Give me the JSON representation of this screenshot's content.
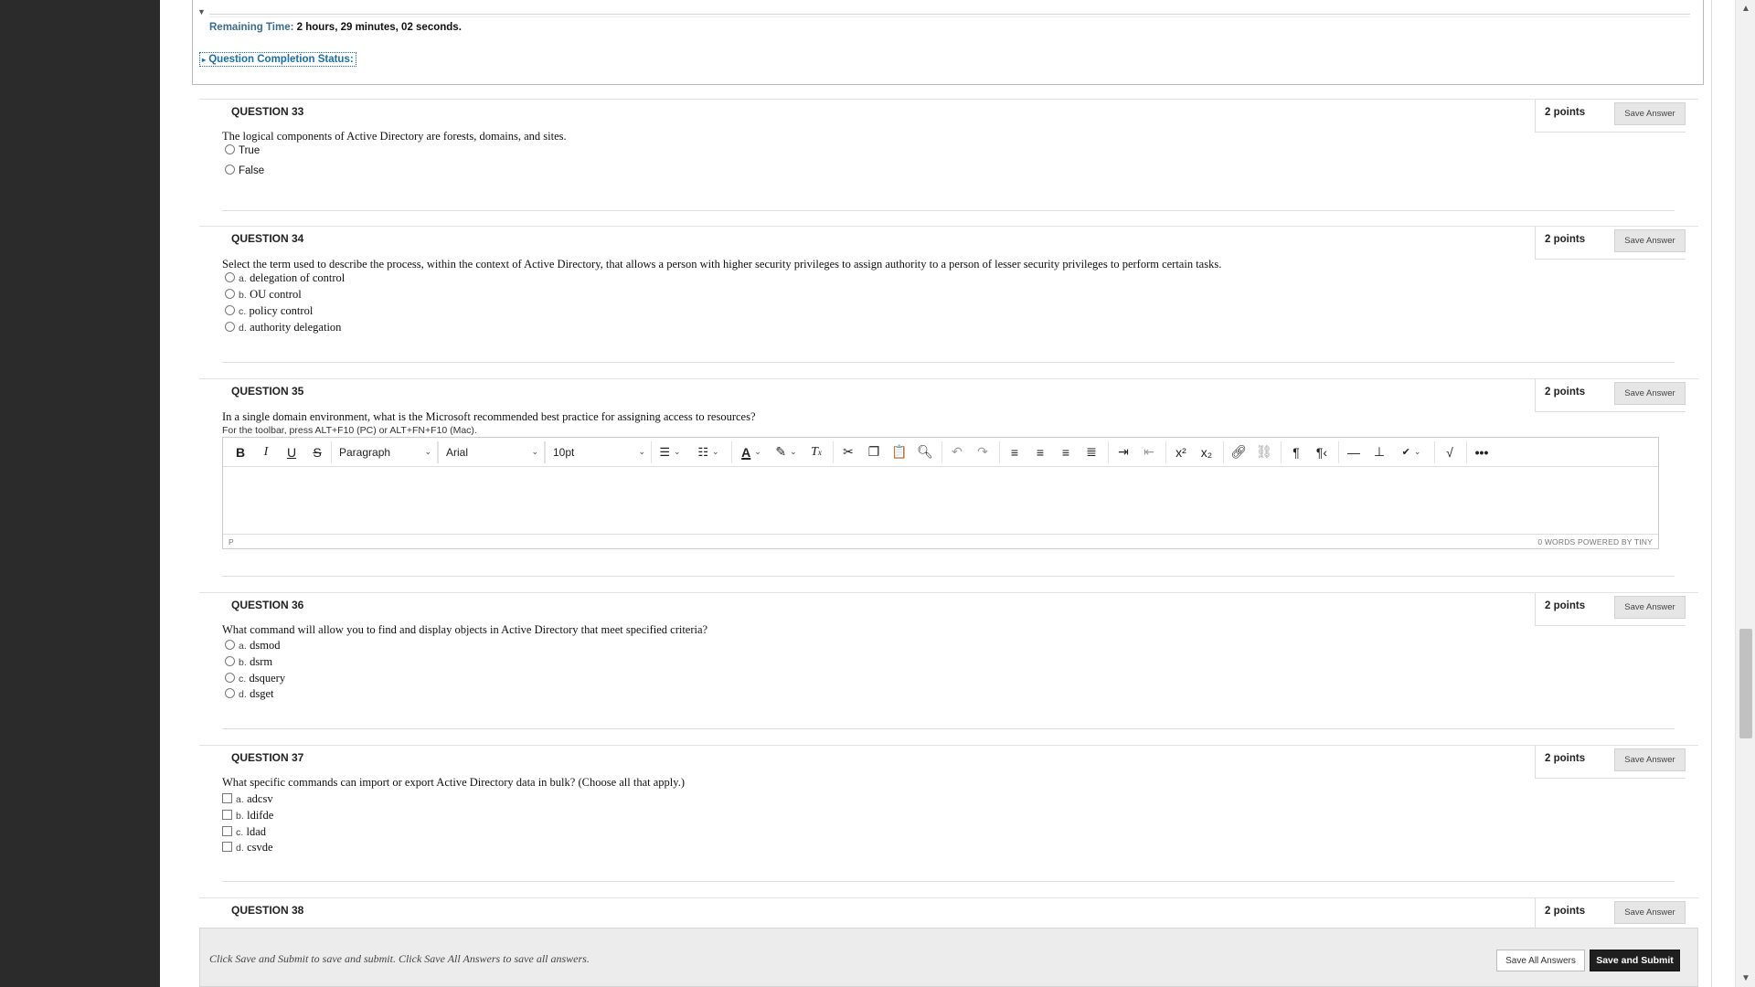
{
  "timer": {
    "label": "Remaining Time:",
    "value": "2 hours, 29 minutes, 02 seconds."
  },
  "completion_status_link": "Question Completion Status:",
  "points_label": "2 points",
  "save_answer_label": "Save Answer",
  "questions": [
    {
      "title": "QUESTION 33",
      "text": "The logical components of Active Directory are forests, domains, and sites.",
      "type": "true-false",
      "options": [
        {
          "letter": "",
          "text": "True"
        },
        {
          "letter": "",
          "text": "False"
        }
      ]
    },
    {
      "title": "QUESTION 34",
      "text": "Select the term used to describe the process, within the context of Active Directory, that allows a person with higher security privileges to assign authority to a person of lesser security privileges to perform certain tasks.",
      "type": "multiple-choice",
      "options": [
        {
          "letter": "a.",
          "text": "delegation of control"
        },
        {
          "letter": "b.",
          "text": "OU control"
        },
        {
          "letter": "c.",
          "text": "policy control"
        },
        {
          "letter": "d.",
          "text": "authority delegation"
        }
      ]
    },
    {
      "title": "QUESTION 35",
      "text": "In a single domain environment, what is the Microsoft recommended best practice for assigning access to resources?",
      "type": "essay",
      "toolbar_hint": "For the toolbar, press ALT+F10 (PC) or ALT+FN+F10 (Mac).",
      "editor": {
        "block_format": "Paragraph",
        "font_family": "Arial",
        "font_size": "10pt",
        "status_path": "P",
        "status_words": "0 WORDS  POWERED BY TINY"
      }
    },
    {
      "title": "QUESTION 36",
      "text": "What command will allow you to find and display objects in Active Directory that meet specified criteria?",
      "type": "multiple-choice",
      "options": [
        {
          "letter": "a.",
          "text": "dsmod"
        },
        {
          "letter": "b.",
          "text": "dsrm"
        },
        {
          "letter": "c.",
          "text": "dsquery"
        },
        {
          "letter": "d.",
          "text": "dsget"
        }
      ]
    },
    {
      "title": "QUESTION 37",
      "text": "What specific commands can import or export Active Directory data in bulk? (Choose all that apply.)",
      "type": "multiple-answer",
      "options": [
        {
          "letter": "a.",
          "text": "adcsv"
        },
        {
          "letter": "b.",
          "text": "ldifde"
        },
        {
          "letter": "c.",
          "text": "ldad"
        },
        {
          "letter": "d.",
          "text": "csvde"
        }
      ]
    },
    {
      "title": "QUESTION 38"
    }
  ],
  "footer": {
    "instructions": "Click Save and Submit to save and submit. Click Save All Answers to save all answers.",
    "save_all_label": "Save All Answers",
    "save_submit_label": "Save and Submit"
  }
}
